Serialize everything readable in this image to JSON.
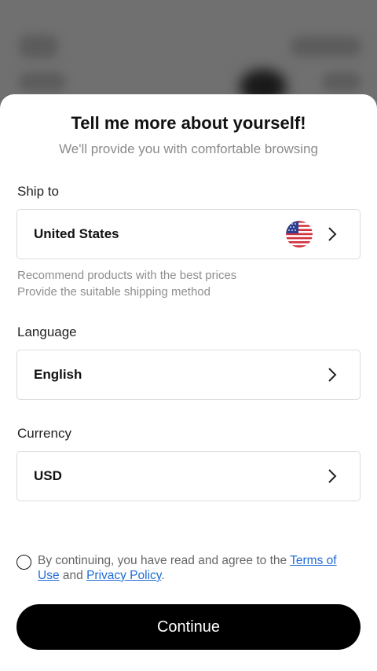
{
  "dialog": {
    "title": "Tell me more about yourself!",
    "subtitle": "We'll provide you with comfortable browsing"
  },
  "ship_to": {
    "label": "Ship to",
    "value": "United States",
    "flag_icon": "us-flag-icon",
    "hint_line1": "Recommend products with the best prices",
    "hint_line2": "Provide the suitable shipping method"
  },
  "language": {
    "label": "Language",
    "value": "English"
  },
  "currency": {
    "label": "Currency",
    "value": "USD"
  },
  "agreement": {
    "prefix": "By continuing, you have read and agree to the ",
    "terms_link": "Terms of Use",
    "conjunction": " and ",
    "privacy_link": "Privacy Policy",
    "suffix": ".",
    "checked": false
  },
  "continue_button": {
    "label": "Continue"
  },
  "colors": {
    "link": "#1f6bd6",
    "button_bg": "#000000",
    "overlay": "#6e6e6e"
  }
}
